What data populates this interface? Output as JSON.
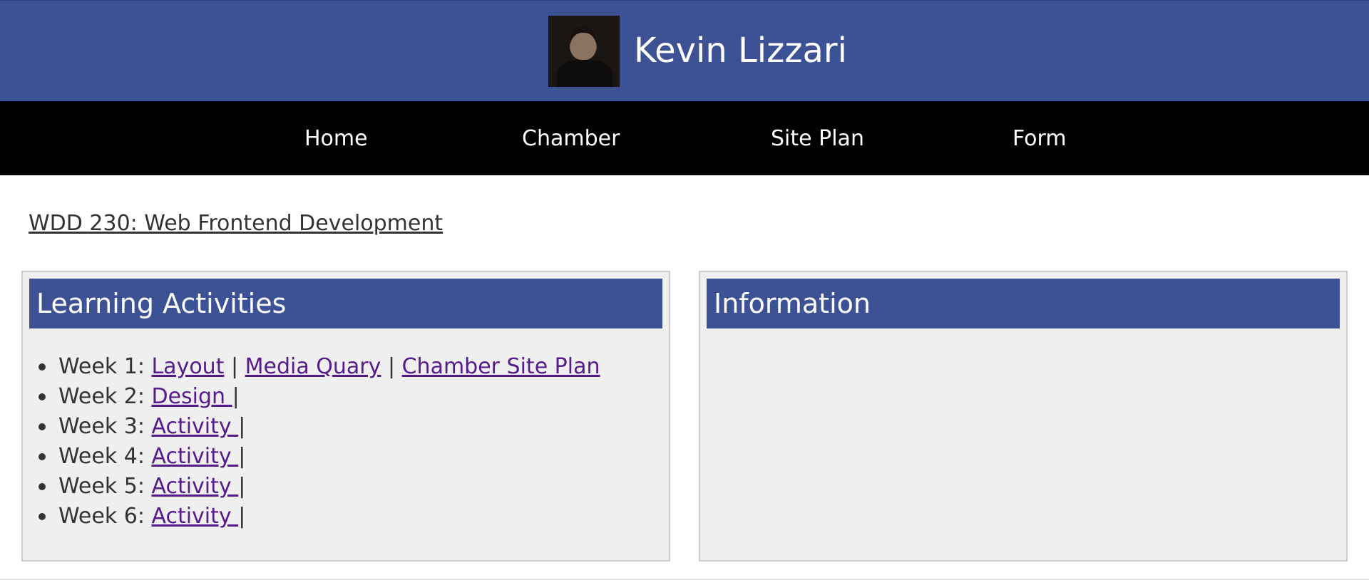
{
  "header": {
    "site_name": "Kevin Lizzari"
  },
  "nav": {
    "items": [
      {
        "label": "Home"
      },
      {
        "label": "Chamber"
      },
      {
        "label": "Site Plan"
      },
      {
        "label": "Form"
      }
    ]
  },
  "course": {
    "title": "WDD 230: Web Frontend Development"
  },
  "cards": {
    "learning": {
      "heading": "Learning Activities",
      "weeks": [
        {
          "label": "Week 1: ",
          "links": [
            "Layout",
            "Media Quary",
            "Chamber Site Plan"
          ]
        },
        {
          "label": "Week 2: ",
          "links": [
            "Design "
          ]
        },
        {
          "label": "Week 3: ",
          "links": [
            "Activity "
          ]
        },
        {
          "label": "Week 4: ",
          "links": [
            "Activity "
          ]
        },
        {
          "label": "Week 5: ",
          "links": [
            "Activity "
          ]
        },
        {
          "label": "Week 6: ",
          "links": [
            "Activity "
          ]
        }
      ],
      "separator": "|"
    },
    "information": {
      "heading": "Information"
    }
  },
  "colors": {
    "header_bg": "#3d5195",
    "nav_bg": "#000000",
    "card_bg": "#efefef",
    "visited_link": "#551a8b"
  }
}
